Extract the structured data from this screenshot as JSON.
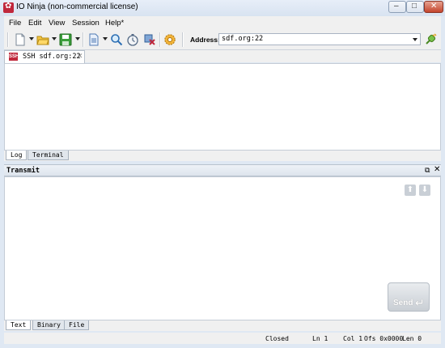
{
  "window": {
    "title": "IO Ninja (non-commercial license)",
    "logo": "ninja-logo"
  },
  "menu": [
    "File",
    "Edit",
    "View",
    "Session",
    "Help*"
  ],
  "toolbar": {
    "icons": [
      "new-session-icon",
      "open-folder-icon",
      "save-icon",
      "document-icon",
      "find-icon",
      "stopwatch-icon",
      "capture-icon",
      "settings-gear-icon"
    ],
    "address_label": "Address:",
    "address_value": "sdf.org:22"
  },
  "session_tab": {
    "label": "SSH sdf.org:22",
    "badge": "SSH"
  },
  "log_tabs": [
    "Log",
    "Terminal"
  ],
  "transmit": {
    "title": "Transmit",
    "send_label": "Send"
  },
  "transmit_tabs": [
    "Text",
    "Binary",
    "File"
  ],
  "status": {
    "state": "Closed",
    "line": "Ln 1",
    "col": "Col 1",
    "offset": "Ofs 0x0000",
    "length": "Len 0"
  }
}
